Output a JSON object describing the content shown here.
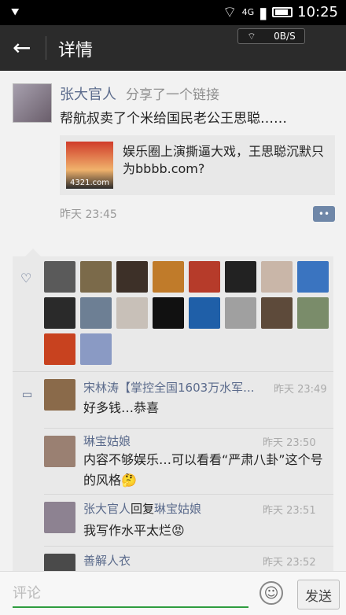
{
  "status_bar": {
    "network": "4G",
    "time": "10:25"
  },
  "net_speed": "0B/S",
  "app_bar": {
    "title": "详情"
  },
  "post": {
    "author": "张大官人",
    "share_text": "分享了一个链接",
    "text": "帮航叔卖了个米给国民老公王思聪……",
    "link": {
      "thumb_caption": "4321.com",
      "title": "娱乐圈上演撕逼大戏，王思聪沉默只为bbbb.com?"
    },
    "time": "昨天 23:45",
    "comment_button": "••"
  },
  "likes": {
    "avatar_colors": [
      "#5a5a5a",
      "#7b6a4a",
      "#3d3028",
      "#c07b2a",
      "#b63b2a",
      "#222222",
      "#c9b6a8",
      "#3a74c0",
      "#2a2a2a",
      "#6d7f94",
      "#c8c0b8",
      "#111111",
      "#1f5fa8",
      "#a0a0a0",
      "#5d4a3a",
      "#7a8c6a",
      "#c8421f",
      "#8a9ac4"
    ]
  },
  "comments": [
    {
      "name": "宋林涛【掌控全国1603万水军...",
      "time": "昨天 23:49",
      "text": "好多钱…恭喜",
      "avatar_color": "#8a6a4a"
    },
    {
      "name": "琳宝姑娘",
      "time": "昨天 23:50",
      "text": "内容不够娱乐…可以看看“严肃八卦”这个号的风格🤔",
      "avatar_color": "#9a8072"
    },
    {
      "name": "张大官人",
      "reply_word": "回复",
      "reply_to": "琳宝姑娘",
      "time": "昨天 23:51",
      "text": "我写作水平太烂😡",
      "avatar_color": "#8d8291"
    },
    {
      "name": "善解人衣",
      "time": "昨天 23:52",
      "text": "",
      "avatar_color": "#4a4a4a"
    }
  ],
  "input": {
    "placeholder": "评论",
    "send_label": "发送"
  }
}
